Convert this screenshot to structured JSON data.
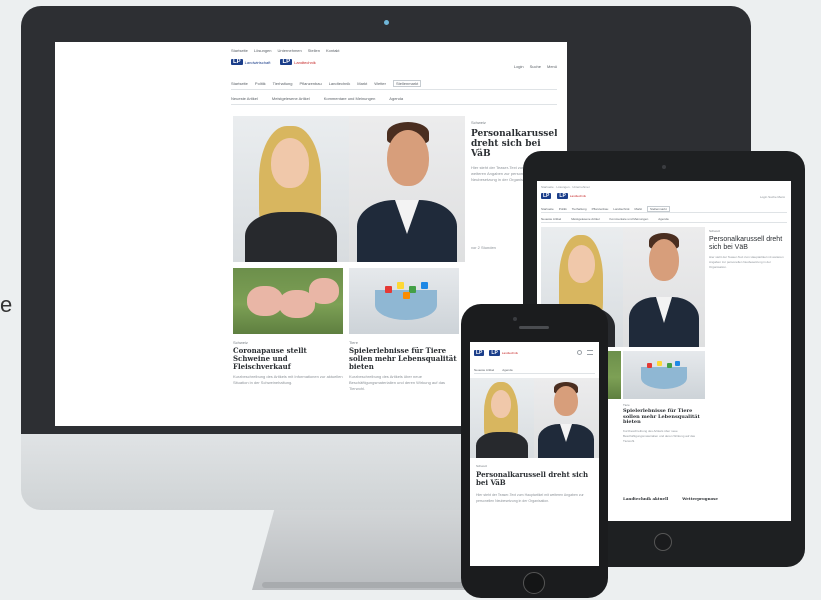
{
  "edge_text": "e",
  "site": {
    "topbar_links": [
      "Startseite",
      "Lösungen",
      "Unternehmen",
      "Stellen",
      "Kontakt"
    ],
    "logo_primary": {
      "mark": "LP",
      "text": "Landwirtschaft"
    },
    "logo_secondary": {
      "mark": "LP",
      "text": "Landtechnik"
    },
    "header_tools": [
      "Login",
      "Suche",
      "Menü"
    ],
    "nav_items": [
      "Startseite",
      "Politik",
      "Tierhaltung",
      "Pflanzenbau",
      "Landtechnik",
      "Markt",
      "Wetter",
      "Stellenmarkt"
    ],
    "subnav_items": [
      "Neueste Artikel",
      "Meistgelesene Artikel",
      "Kommentare und Meinungen",
      "Agenda"
    ],
    "hero": {
      "kicker": "Schweiz",
      "title": "Personalkarussell dreht sich bei VäB",
      "paragraph": "Hier steht der Teaser-Text zum Hauptartikel mit weiteren Angaben zur personellen Neubesetzung in der Organisation.",
      "meta": "vor 2 Stunden"
    },
    "card1": {
      "kicker": "Schweiz",
      "title": "Coronapause stellt Schweine und Fleischverkauf",
      "paragraph": "Kurzbeschreibung des Artikels mit Informationen zur aktuellen Situation in der Schweinehaltung."
    },
    "card2": {
      "kicker": "Tiere",
      "title": "Spielerlebnisse für Tiere sollen mehr Lebensqualität bieten",
      "paragraph": "Kurzbeschreibung des Artikels über neue Beschäftigungsmaterialien und deren Wirkung auf das Tierwohl."
    }
  },
  "tablet": {
    "hero_title": "Personalkarussell dreht sich bei VäB",
    "card_title": "Spielerlebnisse für Tiere sollen mehr Lebensqualität bieten",
    "foot_left": "Landtechnik aktuell",
    "foot_right": "Wetterprognose"
  },
  "phone": {
    "kicker": "Schweiz",
    "hero_title": "Personalkarussell dreht sich bei VäB",
    "paragraph": "Hier steht der Teaser-Text zum Hauptartikel mit weiteren Angaben zur personellen Neubesetzung in der Organisation."
  }
}
